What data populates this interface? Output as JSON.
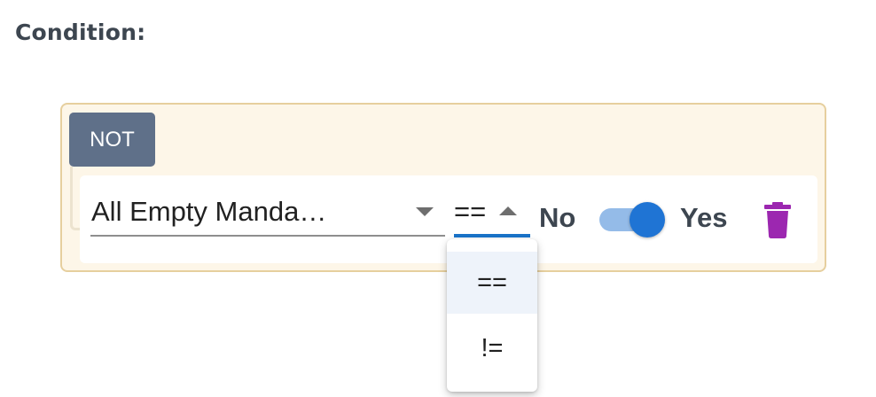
{
  "condition": {
    "title": "Condition:"
  },
  "group": {
    "not_label": "NOT"
  },
  "rule": {
    "field_value": "All Empty Manda…",
    "operator_value": "==",
    "toggle": {
      "off_label": "No",
      "on_label": "Yes",
      "checked": true
    }
  },
  "operator_menu": {
    "options": [
      {
        "label": "==",
        "selected": true
      },
      {
        "label": "!=",
        "selected": false
      }
    ]
  },
  "colors": {
    "group_background": "#fdf6e8",
    "group_border": "#e6cf9e",
    "not_button": "#5f7089",
    "accent_blue": "#1f74d4",
    "delete_icon": "#9c27b0"
  },
  "icons": {
    "field_dropdown": "caret-down-icon",
    "operator_dropdown": "caret-up-icon",
    "delete": "trash-icon"
  }
}
